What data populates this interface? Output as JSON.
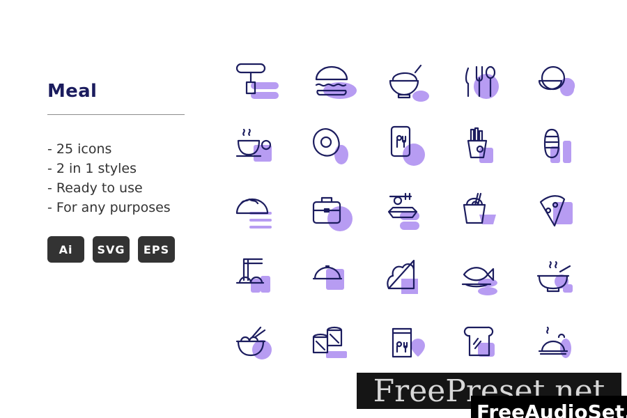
{
  "colors": {
    "title": "#1b1c5e",
    "stroke": "#1b1c5e",
    "accent": "#b79cf2",
    "badge_bg": "#333333",
    "text": "#333333"
  },
  "title": "Meal",
  "features": [
    "- 25 icons",
    "- 2 in 1 styles",
    "- Ready to use",
    "- For any purposes"
  ],
  "formats": [
    "Ai",
    "SVG",
    "EPS"
  ],
  "icons": [
    "sausage-fork-icon",
    "burger-icon",
    "porridge-bowl-icon",
    "cutlery-plate-icon",
    "plates-icon",
    "tea-cup-icon",
    "fried-egg-icon",
    "mobile-order-icon",
    "french-fries-icon",
    "hotdog-icon",
    "taco-icon",
    "lunchbox-icon",
    "takeaway-box-icon",
    "noodle-box-icon",
    "pizza-slice-icon",
    "ramen-chopsticks-icon",
    "cloche-icon",
    "sandwich-icon",
    "fish-plate-icon",
    "soup-bowl-icon",
    "noodle-bowl-icon",
    "sushi-roll-icon",
    "food-bag-icon",
    "toast-icon",
    "roast-chicken-icon"
  ],
  "watermark": {
    "primary": "FreePreset.net",
    "secondary": "FreeAudioSet.net"
  }
}
